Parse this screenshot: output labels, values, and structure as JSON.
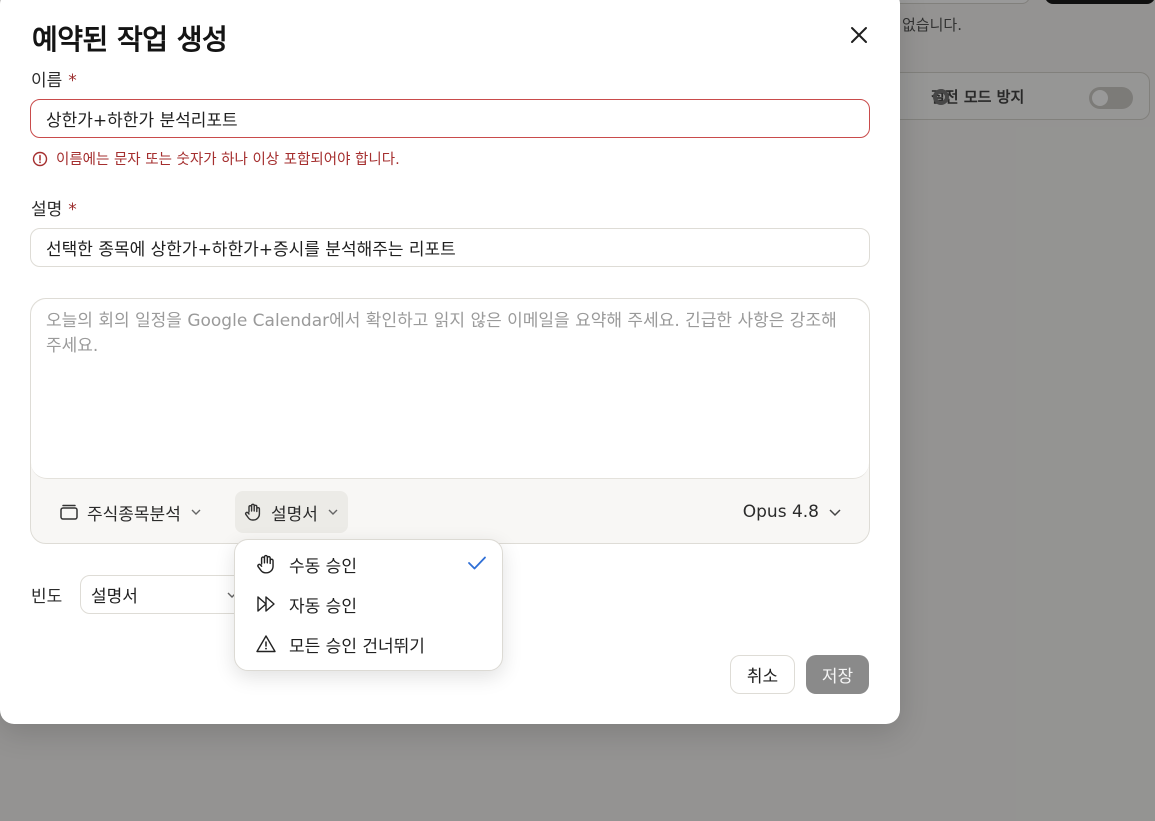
{
  "background": {
    "partial_text": "없습니다.",
    "safe_mode_label": "절전 모드 방지"
  },
  "modal": {
    "title": "예약된 작업 생성",
    "name_field": {
      "label": "이름",
      "required_mark": "*",
      "value": "상한가+하한가 분석리포트",
      "error": "이름에는 문자 또는 숫자가 하나 이상 포함되어야 합니다."
    },
    "description_field": {
      "label": "설명",
      "required_mark": "*",
      "value": "선택한 종목에 상한가+하한가+증시를 분석해주는 리포트"
    },
    "prompt": {
      "placeholder": "오늘의 회의 일정을 Google Calendar에서 확인하고 읽지 않은 이메일을 요약해 주세요. 긴급한 사항은 강조해 주세요."
    },
    "toolbar": {
      "project_label": "주식종목분석",
      "approval_label": "설명서",
      "model_label": "Opus 4.8"
    },
    "frequency": {
      "label": "빈도",
      "value": "설명서"
    },
    "buttons": {
      "cancel": "취소",
      "save": "저장"
    }
  },
  "approval_menu": {
    "items": [
      {
        "label": "수동 승인",
        "icon": "hand-icon",
        "selected": true
      },
      {
        "label": "자동 승인",
        "icon": "fast-forward-icon",
        "selected": false
      },
      {
        "label": "모든 승인 건너뛰기",
        "icon": "warning-icon",
        "selected": false
      }
    ]
  },
  "colors": {
    "error": "#a52f2f",
    "check": "#2f6fd6",
    "save_disabled": "#8a8a8a"
  }
}
